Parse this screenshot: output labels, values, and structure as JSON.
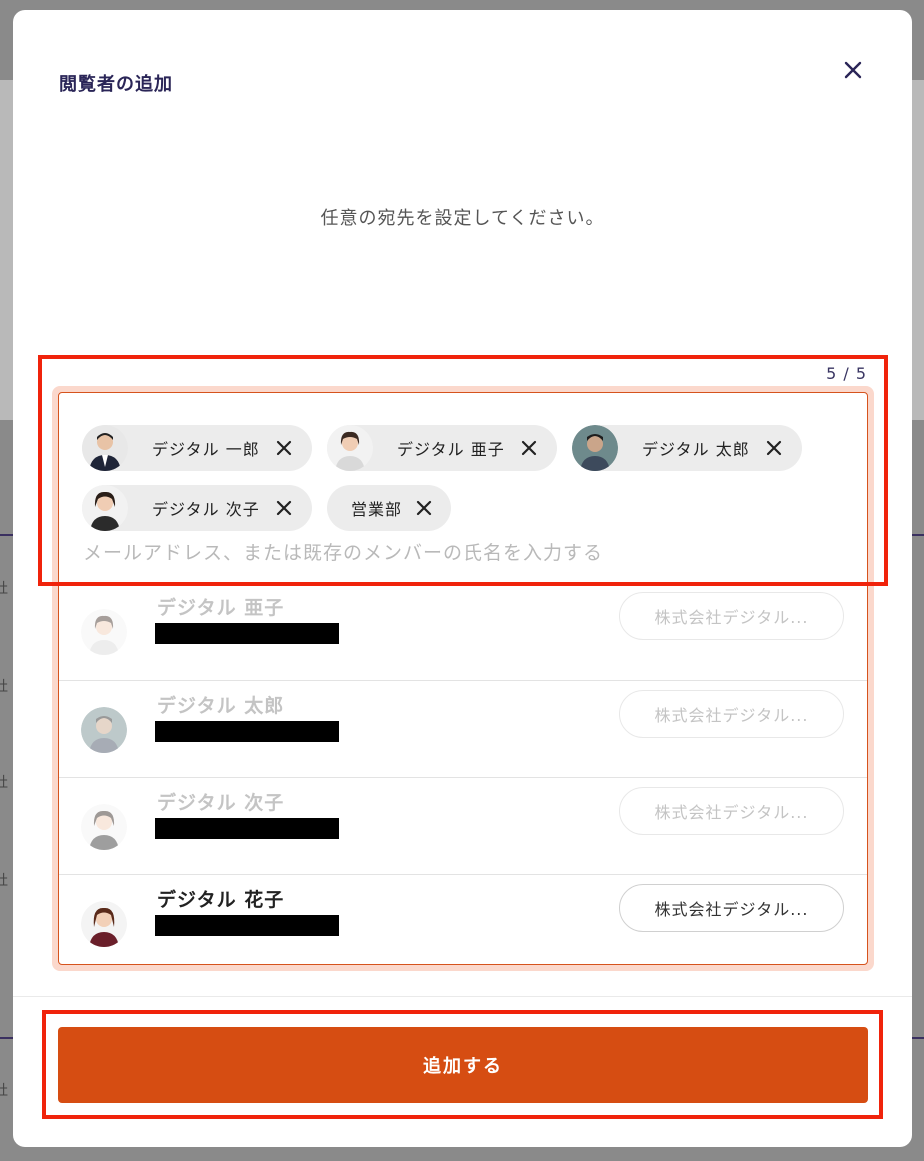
{
  "modal": {
    "title": "閲覧者の追加",
    "instruction": "任意の宛先を設定してください。",
    "counter": "5 / 5",
    "placeholder": "メールアドレス、または既存のメンバーの氏名を入力する",
    "submit_label": "追加する"
  },
  "chips": [
    {
      "name": "デジタル 一郎",
      "avatar": "person-avatar"
    },
    {
      "name": "デジタル 亜子",
      "avatar": "person-avatar"
    },
    {
      "name": "デジタル 太郎",
      "avatar": "person-avatar"
    },
    {
      "name": "デジタル 次子",
      "avatar": "person-avatar"
    },
    {
      "name": "営業部",
      "avatar": ""
    }
  ],
  "suggestions": [
    {
      "name": "デジタル 亜子",
      "org": "株式会社デジタル...",
      "disabled": true
    },
    {
      "name": "デジタル 太郎",
      "org": "株式会社デジタル...",
      "disabled": true
    },
    {
      "name": "デジタル 次子",
      "org": "株式会社デジタル...",
      "disabled": true
    },
    {
      "name": "デジタル 花子",
      "org": "株式会社デジタル...",
      "disabled": false
    }
  ],
  "background": {
    "edge_chars": [
      "社",
      "社",
      "社",
      "社",
      "社"
    ]
  },
  "colors": {
    "accent": "#d64d12",
    "highlight": "#f0230b",
    "title": "#2a2557",
    "chip_bg": "#ececec"
  },
  "icons": {
    "close": "close-icon",
    "remove": "remove-chip-icon"
  }
}
